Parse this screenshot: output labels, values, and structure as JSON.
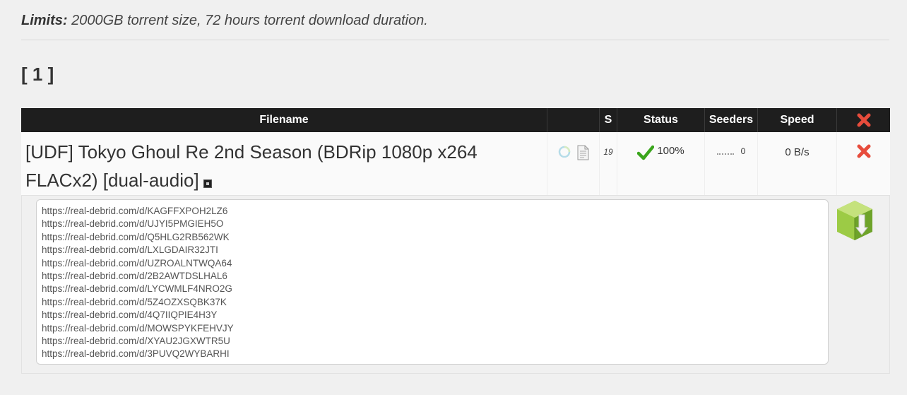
{
  "limits": {
    "label": "Limits:",
    "text": " 2000GB torrent size, 72 hours torrent download duration."
  },
  "page_indicator": "[ 1 ]",
  "table": {
    "headers": {
      "filename": "Filename",
      "icons": "",
      "s": "S",
      "status": "Status",
      "seeders": "Seeders",
      "speed": "Speed"
    },
    "row": {
      "filename": "[UDF] Tokyo Ghoul Re 2nd Season (BDRip 1080p x264 FLACx2) [dual-audio]",
      "s": "19",
      "status": "100%",
      "seeders": "0",
      "speed": "0 B/s"
    }
  },
  "links": [
    "https://real-debrid.com/d/KAGFFXPOH2LZ6",
    "https://real-debrid.com/d/UJYI5PMGIEH5O",
    "https://real-debrid.com/d/Q5HLG2RB562WK",
    "https://real-debrid.com/d/LXLGDAIR32JTI",
    "https://real-debrid.com/d/UZROALNTWQA64",
    "https://real-debrid.com/d/2B2AWTDSLHAL6",
    "https://real-debrid.com/d/LYCWMLF4NRO2G",
    "https://real-debrid.com/d/5Z4OZXSQBK37K",
    "https://real-debrid.com/d/4Q7IIQPIE4H3Y",
    "https://real-debrid.com/d/MOWSPYKFEHVJY",
    "https://real-debrid.com/d/XYAU2JGXWTR5U",
    "https://real-debrid.com/d/3PUVQ2WYBARHI"
  ],
  "colors": {
    "header_bg": "#1e1e1e",
    "delete_red": "#e74c3c",
    "check_green": "#3aa51c",
    "download_green": "#8fc43a"
  },
  "icons": {
    "header_delete": "close-x-icon",
    "row_delete": "close-x-icon",
    "status_check": "checkmark-icon",
    "progress": "circle-loader-icon",
    "file": "document-icon",
    "download": "download-box-icon"
  }
}
